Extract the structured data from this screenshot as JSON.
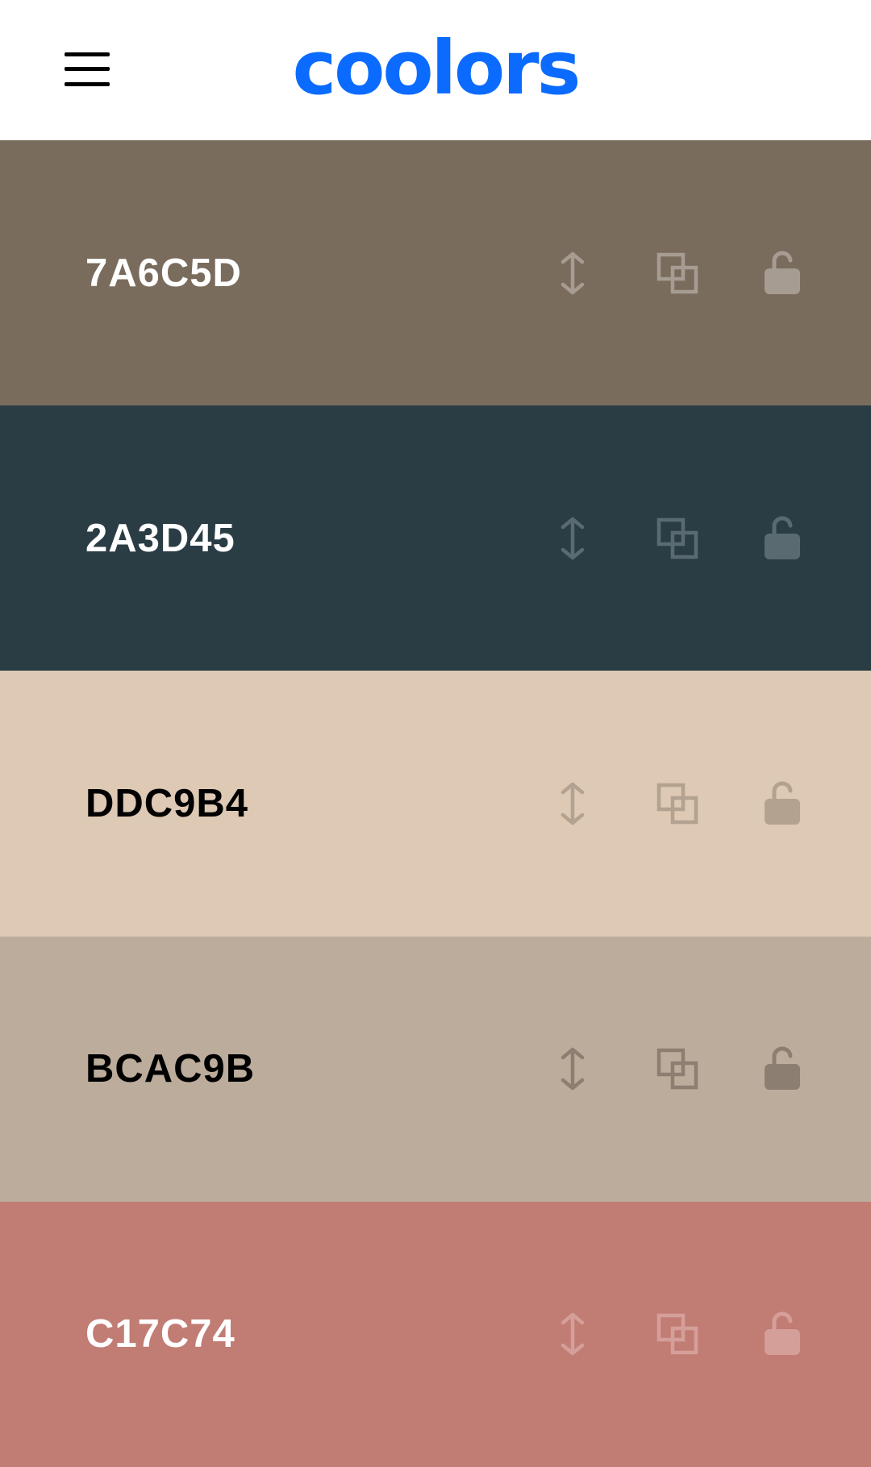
{
  "header": {
    "logo_text": "coolors",
    "logo_color": "#0B6BFF",
    "menu_icon": "hamburger-icon"
  },
  "swatches": [
    {
      "hex": "7A6C5D",
      "bg": "#7A6C5D",
      "text_color": "#FFFFFF",
      "icon_color": "#A69C92"
    },
    {
      "hex": "2A3D45",
      "bg": "#2A3D45",
      "text_color": "#FFFFFF",
      "icon_color": "#5A6A71"
    },
    {
      "hex": "DDC9B4",
      "bg": "#DDC9B4",
      "text_color": "#000000",
      "icon_color": "#B3A290"
    },
    {
      "hex": "BCAC9B",
      "bg": "#BCAC9B",
      "text_color": "#000000",
      "icon_color": "#8C7F72"
    },
    {
      "hex": "C17C74",
      "bg": "#C17C74",
      "text_color": "#FFFFFF",
      "icon_color": "#D59F99"
    }
  ],
  "tool_icons": [
    "drag-vertical-icon",
    "copy-icon",
    "unlock-icon"
  ]
}
